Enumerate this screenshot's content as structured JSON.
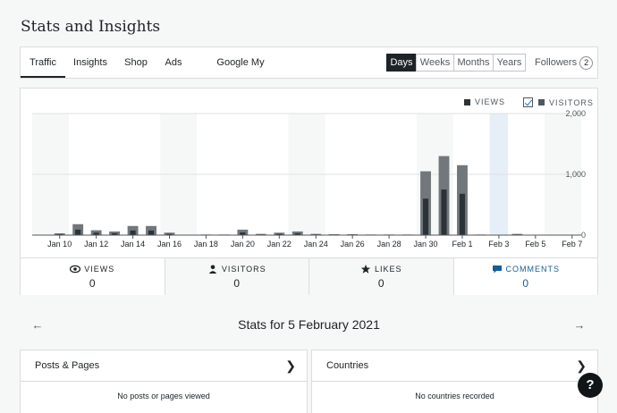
{
  "page_title": "Stats and Insights",
  "nav": {
    "tabs": [
      "Traffic",
      "Insights",
      "Shop",
      "Ads",
      "Google My Business"
    ],
    "active_tab": "Traffic",
    "periods": [
      "Days",
      "Weeks",
      "Months",
      "Years"
    ],
    "active_period": "Days",
    "followers_label": "Followers",
    "followers_count": "2"
  },
  "chart_legend": {
    "views": "VIEWS",
    "visitors": "VISITORS"
  },
  "colors": {
    "views": "#2c3338",
    "visitors": "#72777c",
    "highlight": "#e6eef8",
    "weekend": "#f6f7f7",
    "comments": "#135e96"
  },
  "chart_data": {
    "type": "bar",
    "categories": [
      "Jan 9",
      "Jan 10",
      "Jan 11",
      "Jan 12",
      "Jan 13",
      "Jan 14",
      "Jan 15",
      "Jan 16",
      "Jan 17",
      "Jan 18",
      "Jan 19",
      "Jan 20",
      "Jan 21",
      "Jan 22",
      "Jan 23",
      "Jan 24",
      "Jan 25",
      "Jan 26",
      "Jan 27",
      "Jan 28",
      "Jan 29",
      "Jan 30",
      "Jan 31",
      "Feb 1",
      "Feb 2",
      "Feb 3",
      "Feb 4",
      "Feb 5",
      "Feb 6",
      "Feb 7"
    ],
    "tick_labels": [
      "Jan 10",
      "Jan 12",
      "Jan 14",
      "Jan 16",
      "Jan 18",
      "Jan 20",
      "Jan 22",
      "Jan 24",
      "Jan 26",
      "Jan 28",
      "Jan 30",
      "Feb 1",
      "Feb 3",
      "Feb 5",
      "Feb 7"
    ],
    "y_ticks": [
      "2,000",
      "1,000",
      "0"
    ],
    "ylim": [
      0,
      2000
    ],
    "series": [
      {
        "name": "VISITORS",
        "values": [
          5,
          30,
          180,
          80,
          60,
          150,
          150,
          40,
          5,
          10,
          10,
          90,
          20,
          40,
          60,
          20,
          15,
          15,
          10,
          10,
          10,
          1050,
          1300,
          1150,
          10,
          5,
          20,
          5,
          5,
          5
        ]
      },
      {
        "name": "VIEWS",
        "values": [
          2,
          15,
          90,
          40,
          30,
          75,
          75,
          20,
          2,
          5,
          5,
          45,
          10,
          20,
          30,
          10,
          8,
          8,
          5,
          5,
          5,
          600,
          750,
          680,
          5,
          2,
          10,
          2,
          2,
          2
        ]
      }
    ],
    "highlighted_category": "Feb 3",
    "grid": true
  },
  "stats_tabs": [
    {
      "icon": "eye-icon",
      "label": "VIEWS",
      "value": "0"
    },
    {
      "icon": "person-icon",
      "label": "VISITORS",
      "value": "0"
    },
    {
      "icon": "star-icon",
      "label": "LIKES",
      "value": "0"
    },
    {
      "icon": "comment-icon",
      "label": "COMMENTS",
      "value": "0"
    }
  ],
  "date_title": "Stats for 5 February 2021",
  "panels": [
    {
      "title": "Posts & Pages",
      "empty": "No posts or pages viewed"
    },
    {
      "title": "Countries",
      "empty": "No countries recorded"
    }
  ],
  "help_label": "?"
}
